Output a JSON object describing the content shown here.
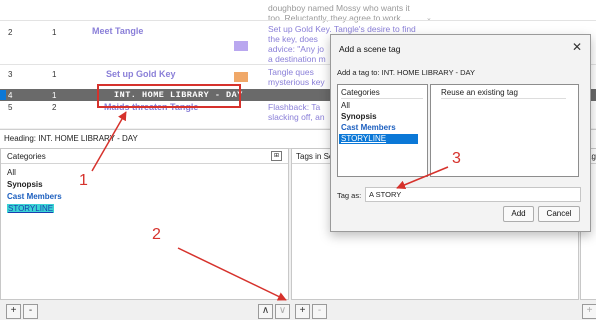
{
  "outline": {
    "rows": [
      {
        "num": "",
        "num2": "",
        "title": "",
        "summary": [
          "doughboy named Mossy who wants it",
          "too. Reluctantly, they agree to work"
        ]
      },
      {
        "num": "2",
        "num2": "1",
        "title": "Meet Tangle",
        "summary": [
          "Set up Gold Key. Tangle's desire to find",
          "the key, does",
          "advice: \"Any jo",
          "a destination m"
        ]
      },
      {
        "num": "3",
        "num2": "1",
        "title": "Set up Gold Key",
        "summary": [
          "Tangle ques",
          "mysterious key"
        ]
      },
      {
        "num": "4",
        "num2": "1",
        "title": "INT. HOME LIBRARY - DAY",
        "summary": [
          ""
        ]
      },
      {
        "num": "5",
        "num2": "2",
        "title": "Maids threaten Tangle",
        "summary": [
          "Flashback: Ta",
          "slacking off, an"
        ]
      }
    ]
  },
  "heading": {
    "label": "Heading: INT. HOME LIBRARY - DAY"
  },
  "left_pane": {
    "header": "Categories",
    "items": [
      "All",
      "Synopsis",
      "Cast Members",
      "STORYLINE"
    ]
  },
  "mid_pane": {
    "header": "Tags in Sc"
  },
  "right_pane": {
    "header": "Tags"
  },
  "dialog": {
    "title": "Add a scene tag",
    "subtitle": "Add a tag to:  INT. HOME LIBRARY - DAY",
    "categories_header": "Categories",
    "categories": [
      "All",
      "Synopsis",
      "Cast Members",
      "STORYLINE"
    ],
    "reuse_header": "Reuse an existing tag",
    "tag_as_label": "Tag as:",
    "tag_as_value": "A STORY",
    "add_label": "Add",
    "cancel_label": "Cancel"
  },
  "annotations": {
    "one": "1",
    "two": "2",
    "three": "3"
  },
  "buttons": {
    "plus": "+",
    "minus": "-",
    "up": "∧",
    "down": "∨"
  },
  "colors": {
    "accent_red": "#d6322c",
    "selection_blue": "#0b78d7",
    "title_purple": "#8a7fd8",
    "highlight_cyan": "#3bd4d4"
  }
}
